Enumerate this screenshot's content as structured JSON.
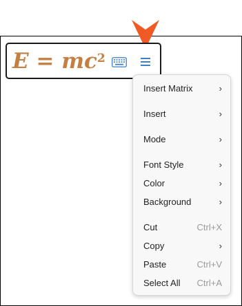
{
  "colors": {
    "formula": "#c47f45",
    "arrow": "#f05a24",
    "icon": "#3d7ec8"
  },
  "mathfield": {
    "base": "E = mc",
    "exponent": "2",
    "keyboard_icon": "keyboard-icon",
    "menu_icon": "hamburger-menu-icon"
  },
  "menu": {
    "items": [
      {
        "label": "Insert Matrix",
        "submenu": true
      },
      {
        "label": "Insert",
        "submenu": true
      },
      {
        "label": "Mode",
        "submenu": true
      },
      {
        "label": "Font Style",
        "submenu": true
      },
      {
        "label": "Color",
        "submenu": true
      },
      {
        "label": "Background",
        "submenu": true
      },
      {
        "label": "Cut",
        "shortcut": "Ctrl+X"
      },
      {
        "label": "Copy",
        "submenu": true
      },
      {
        "label": "Paste",
        "shortcut": "Ctrl+V"
      },
      {
        "label": "Select All",
        "shortcut": "Ctrl+A"
      }
    ],
    "chevron": "›"
  }
}
